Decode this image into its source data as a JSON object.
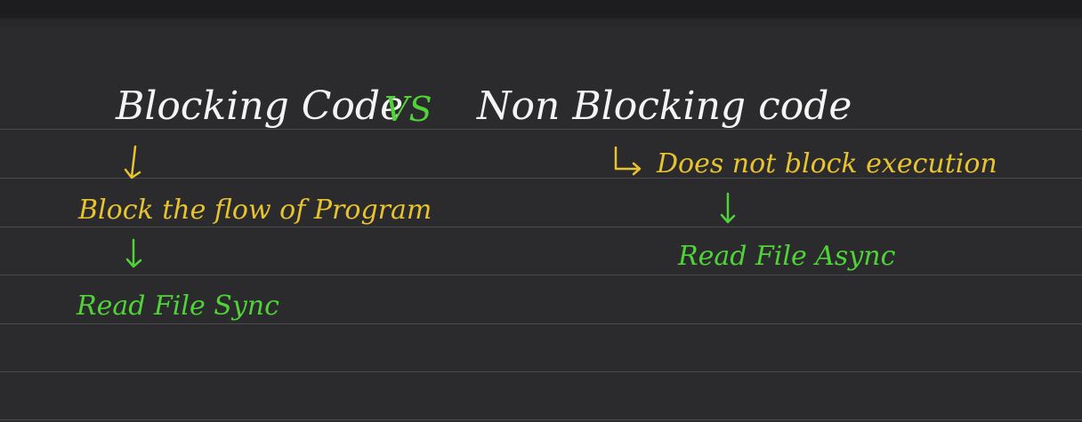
{
  "note": {
    "title_left": "Blocking Code",
    "title_vs": "VS",
    "title_right": "Non Blocking code",
    "left_description": "Block the flow of Program",
    "left_example": "Read File Sync",
    "right_description": "Does not block execution",
    "right_example": "Read File Async"
  },
  "colors": {
    "background": "#2b2b2d",
    "ruling": "#4a4a4d",
    "white_ink": "#f4f4f4",
    "yellow_ink": "#e8c330",
    "green_ink": "#4fd338"
  }
}
